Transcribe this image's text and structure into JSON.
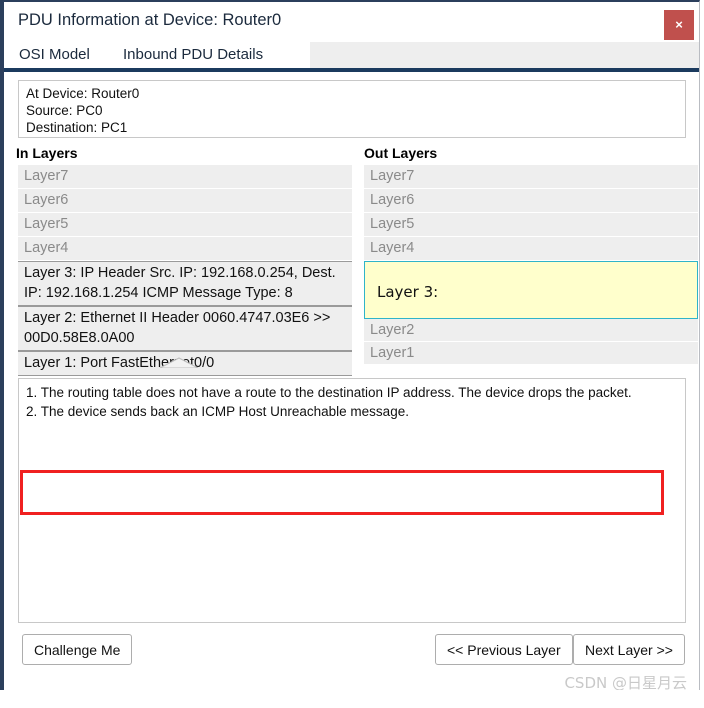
{
  "window": {
    "title": "PDU Information at Device: Router0",
    "close_label": "×",
    "accent_border": "#2b3f5c",
    "close_color": "#c0504d"
  },
  "tabs": [
    {
      "label": "OSI Model",
      "active": true
    },
    {
      "label": "Inbound PDU Details",
      "active": false
    }
  ],
  "device_info": {
    "at_device": "At Device: Router0",
    "source": "Source: PC0",
    "destination": "Destination: PC1"
  },
  "columns": {
    "in_heading": "In Layers",
    "out_heading": "Out Layers"
  },
  "in_layers": [
    {
      "label": "Layer7",
      "state": "inactive"
    },
    {
      "label": "Layer6",
      "state": "inactive"
    },
    {
      "label": "Layer5",
      "state": "inactive"
    },
    {
      "label": "Layer4",
      "state": "inactive"
    },
    {
      "label": "Layer 3: IP Header Src. IP: 192.168.0.254, Dest. IP: 192.168.1.254 ICMP Message Type: 8",
      "state": "active"
    },
    {
      "label": "Layer 2: Ethernet II Header 0060.4747.03E6 >> 00D0.58E8.0A00",
      "state": "active"
    },
    {
      "label": "Layer 1: Port FastEthernet0/0",
      "state": "active"
    }
  ],
  "out_layers": [
    {
      "label": "Layer7",
      "state": "inactive"
    },
    {
      "label": "Layer6",
      "state": "inactive"
    },
    {
      "label": "Layer5",
      "state": "inactive"
    },
    {
      "label": "Layer4",
      "state": "inactive"
    },
    {
      "label": "Layer 3:",
      "state": "highlight"
    },
    {
      "label": "Layer2",
      "state": "inactive"
    },
    {
      "label": "Layer1",
      "state": "inactive"
    }
  ],
  "highlight_colors": {
    "background": "#ffffcc",
    "border": "#2fb4c9"
  },
  "description": {
    "line1": "1. The routing table does not have a route to the destination IP address. The device drops the packet.",
    "line2": "2. The device sends back an ICMP Host Unreachable message."
  },
  "annotation": {
    "color": "#f02020"
  },
  "footer": {
    "challenge_label": "Challenge Me",
    "previous_label": "<< Previous Layer",
    "next_label": "Next Layer >>"
  },
  "watermark": {
    "text": "CSDN @日星月云"
  }
}
